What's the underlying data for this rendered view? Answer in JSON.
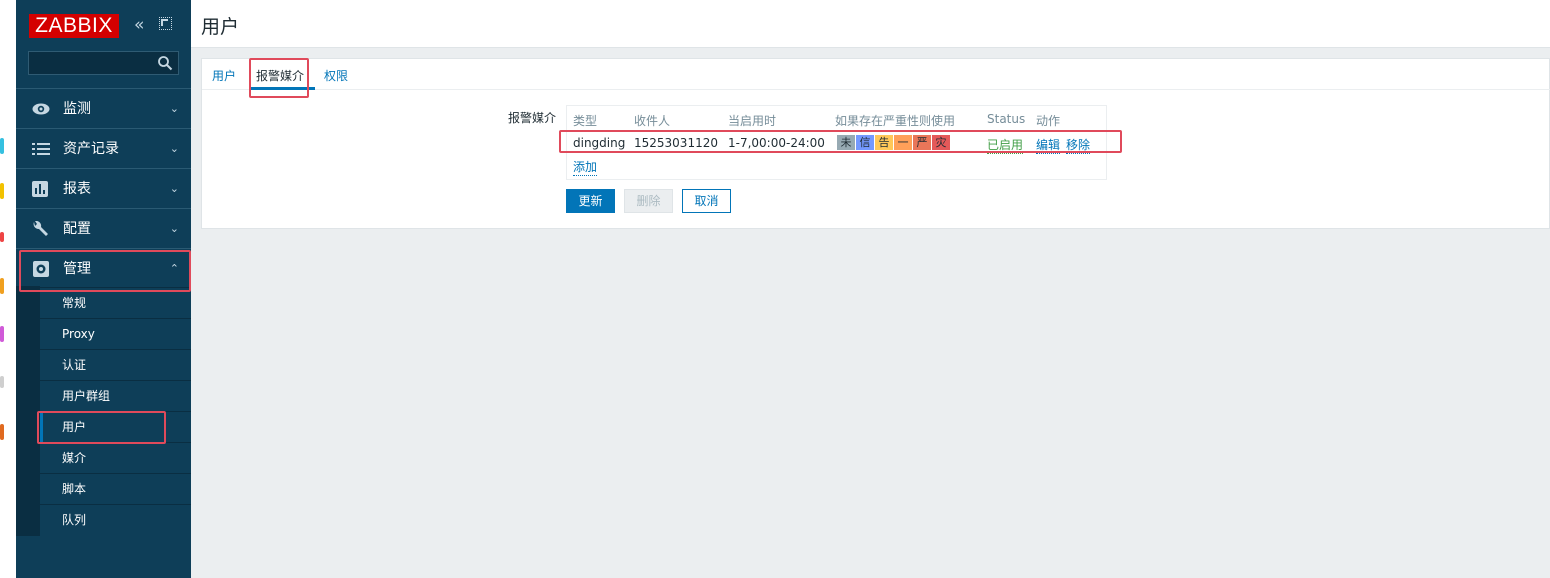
{
  "sidebar": {
    "logo": "ZABBIX",
    "collapse_icon": "«",
    "search": {
      "value": "",
      "placeholder": ""
    },
    "nav": [
      {
        "label": "监测",
        "icon": "eye-icon",
        "chevron": "⌄"
      },
      {
        "label": "资产记录",
        "icon": "list-icon",
        "chevron": "⌄"
      },
      {
        "label": "报表",
        "icon": "bar-chart-icon",
        "chevron": "⌄"
      },
      {
        "label": "配置",
        "icon": "wrench-icon",
        "chevron": "⌄"
      },
      {
        "label": "管理",
        "icon": "gear-icon",
        "chevron": "⌃"
      }
    ],
    "admin_submenu": [
      "常规",
      "Proxy",
      "认证",
      "用户群组",
      "用户",
      "媒介",
      "脚本",
      "队列"
    ]
  },
  "header": {
    "title": "用户"
  },
  "tabs": [
    "用户",
    "报警媒介",
    "权限"
  ],
  "form": {
    "label": "报警媒介",
    "columns": [
      "类型",
      "收件人",
      "当启用时",
      "如果存在严重性则使用",
      "Status",
      "动作"
    ],
    "row": {
      "type": "dingding",
      "send_to": "15253031120",
      "when_active": "1-7,00:00-24:00",
      "severities": [
        {
          "label": "未",
          "color": "#97aab3"
        },
        {
          "label": "信",
          "color": "#7499ff"
        },
        {
          "label": "告",
          "color": "#ffc859"
        },
        {
          "label": "一",
          "color": "#ffa059"
        },
        {
          "label": "严",
          "color": "#e97659"
        },
        {
          "label": "灾",
          "color": "#e45959"
        }
      ],
      "status": "已启用",
      "actions": [
        "编辑",
        "移除"
      ]
    },
    "add_link": "添加"
  },
  "buttons": {
    "update": "更新",
    "delete": "删除",
    "cancel": "取消"
  },
  "colors": {
    "sidebar": "#0e3e58",
    "accent": "#0275b8",
    "highlight": "#e04a5b",
    "logo": "#d40000"
  }
}
